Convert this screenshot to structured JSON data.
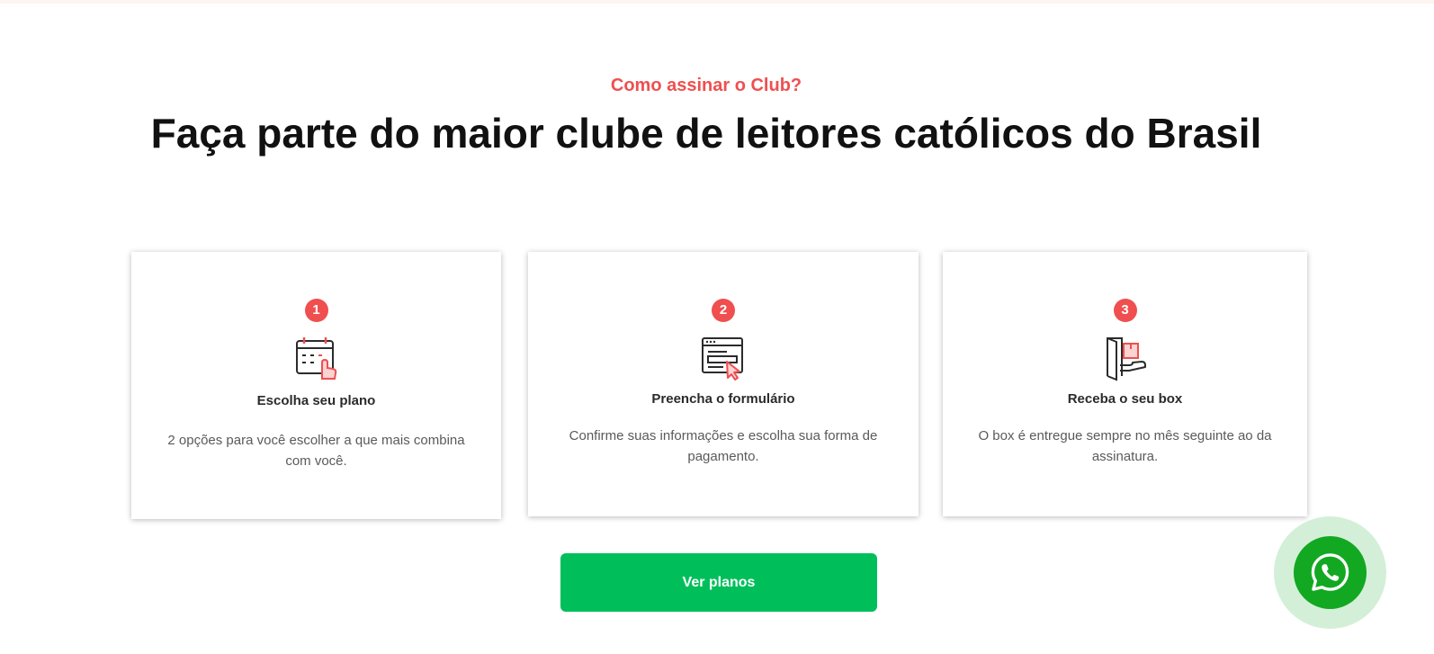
{
  "section": {
    "eyebrow": "Como assinar o Club?",
    "headline": "Faça parte do maior clube de leitores católicos do Brasil"
  },
  "steps": [
    {
      "number": "1",
      "icon": "calendar-click-icon",
      "title": "Escolha seu plano",
      "description": "2 opções para você escolher a que mais combina com você."
    },
    {
      "number": "2",
      "icon": "browser-form-icon",
      "title": "Preencha o formulário",
      "description": "Confirme suas informações e escolha sua forma de pagamento."
    },
    {
      "number": "3",
      "icon": "box-delivery-icon",
      "title": "Receba o seu box",
      "description": "O box é entregue sempre no mês seguinte ao da assinatura."
    }
  ],
  "cta": {
    "label": "Ver planos"
  },
  "whatsapp": {
    "icon": "whatsapp-icon"
  },
  "colors": {
    "accent": "#ef4f4f",
    "cta": "#00bf5b",
    "whatsapp": "#13a821",
    "whatsapp_halo": "#d4efd8"
  }
}
